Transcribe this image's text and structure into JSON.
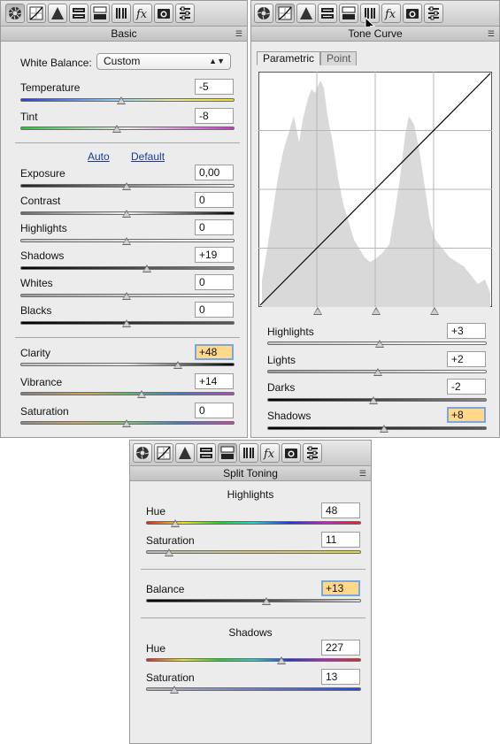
{
  "basic_panel": {
    "title": "Basic",
    "white_balance": {
      "label": "White Balance:",
      "value": "Custom"
    },
    "auto_label": "Auto",
    "default_label": "Default",
    "sliders": [
      {
        "label": "Temperature",
        "value": "-5"
      },
      {
        "label": "Tint",
        "value": "-8"
      },
      {
        "label": "Exposure",
        "value": "0,00"
      },
      {
        "label": "Contrast",
        "value": "0"
      },
      {
        "label": "Highlights",
        "value": "0"
      },
      {
        "label": "Shadows",
        "value": "+19"
      },
      {
        "label": "Whites",
        "value": "0"
      },
      {
        "label": "Blacks",
        "value": "0"
      },
      {
        "label": "Clarity",
        "value": "+48"
      },
      {
        "label": "Vibrance",
        "value": "+14"
      },
      {
        "label": "Saturation",
        "value": "0"
      }
    ]
  },
  "tone_curve_panel": {
    "title": "Tone Curve",
    "tabs": [
      "Parametric",
      "Point"
    ],
    "active_tab": "Parametric",
    "sliders": [
      {
        "label": "Highlights",
        "value": "+3"
      },
      {
        "label": "Lights",
        "value": "+2"
      },
      {
        "label": "Darks",
        "value": "-2"
      },
      {
        "label": "Shadows",
        "value": "+8"
      }
    ]
  },
  "split_toning_panel": {
    "title": "Split Toning",
    "highlights_heading": "Highlights",
    "shadows_heading": "Shadows",
    "highlights_hue": {
      "label": "Hue",
      "value": "48"
    },
    "highlights_saturation": {
      "label": "Saturation",
      "value": "11"
    },
    "balance": {
      "label": "Balance",
      "value": "+13"
    },
    "shadows_hue": {
      "label": "Hue",
      "value": "227"
    },
    "shadows_saturation": {
      "label": "Saturation",
      "value": "13"
    }
  },
  "toolbar_icons": [
    "aperture-icon",
    "tone-curve-icon",
    "detail-icon",
    "hsl-icon",
    "split-toning-icon",
    "lens-corrections-icon",
    "effects-icon",
    "camera-calibration-icon",
    "presets-icon"
  ],
  "colors": {
    "highlight_field": "#ffd88a",
    "focus_ring": "#7aa7e0",
    "link": "#1a3a9a"
  }
}
